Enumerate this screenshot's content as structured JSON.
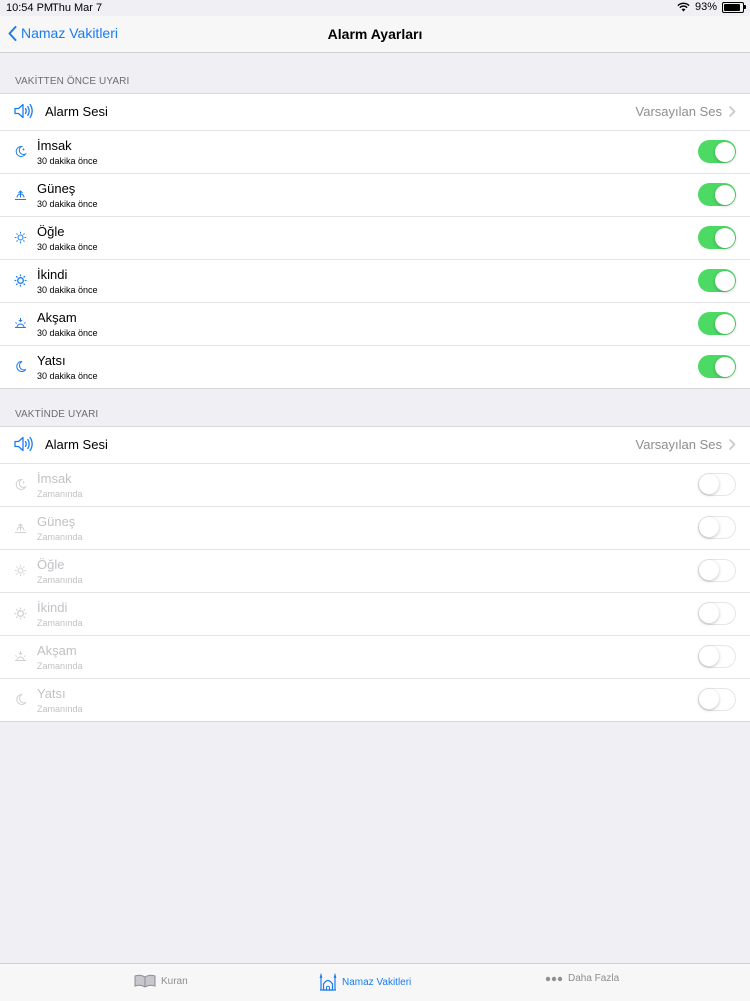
{
  "status": {
    "time": "10:54 PM",
    "date": "Thu Mar 7",
    "battery": "93%"
  },
  "nav": {
    "back_label": "Namaz Vakitleri",
    "title": "Alarm Ayarları"
  },
  "before": {
    "header": "VAKİTTEN ÖNCE UYARI",
    "sound_label": "Alarm Sesi",
    "sound_value": "Varsayılan Ses",
    "prayers": [
      {
        "name": "İmsak",
        "sub": "30 dakika önce",
        "enabled": true
      },
      {
        "name": "Güneş",
        "sub": "30 dakika önce",
        "enabled": true
      },
      {
        "name": "Öğle",
        "sub": "30 dakika önce",
        "enabled": true
      },
      {
        "name": "İkindi",
        "sub": "30 dakika önce",
        "enabled": true
      },
      {
        "name": "Akşam",
        "sub": "30 dakika önce",
        "enabled": true
      },
      {
        "name": "Yatsı",
        "sub": "30 dakika önce",
        "enabled": true
      }
    ]
  },
  "ontime": {
    "header": "VAKTİNDE UYARI",
    "sound_label": "Alarm Sesi",
    "sound_value": "Varsayılan Ses",
    "prayers": [
      {
        "name": "İmsak",
        "sub": "Zamanında",
        "enabled": false
      },
      {
        "name": "Güneş",
        "sub": "Zamanında",
        "enabled": false
      },
      {
        "name": "Öğle",
        "sub": "Zamanında",
        "enabled": false
      },
      {
        "name": "İkindi",
        "sub": "Zamanında",
        "enabled": false
      },
      {
        "name": "Akşam",
        "sub": "Zamanında",
        "enabled": false
      },
      {
        "name": "Yatsı",
        "sub": "Zamanında",
        "enabled": false
      }
    ]
  },
  "tabs": [
    {
      "label": "Kuran",
      "icon": "book-icon",
      "active": false
    },
    {
      "label": "Namaz Vakitleri",
      "icon": "mosque-icon",
      "active": true
    },
    {
      "label": "Daha Fazla",
      "icon": "ellipsis-icon",
      "active": false
    }
  ],
  "colors": {
    "accent": "#1a7cf0",
    "switch_on": "#4cd964",
    "background": "#efeff4"
  }
}
